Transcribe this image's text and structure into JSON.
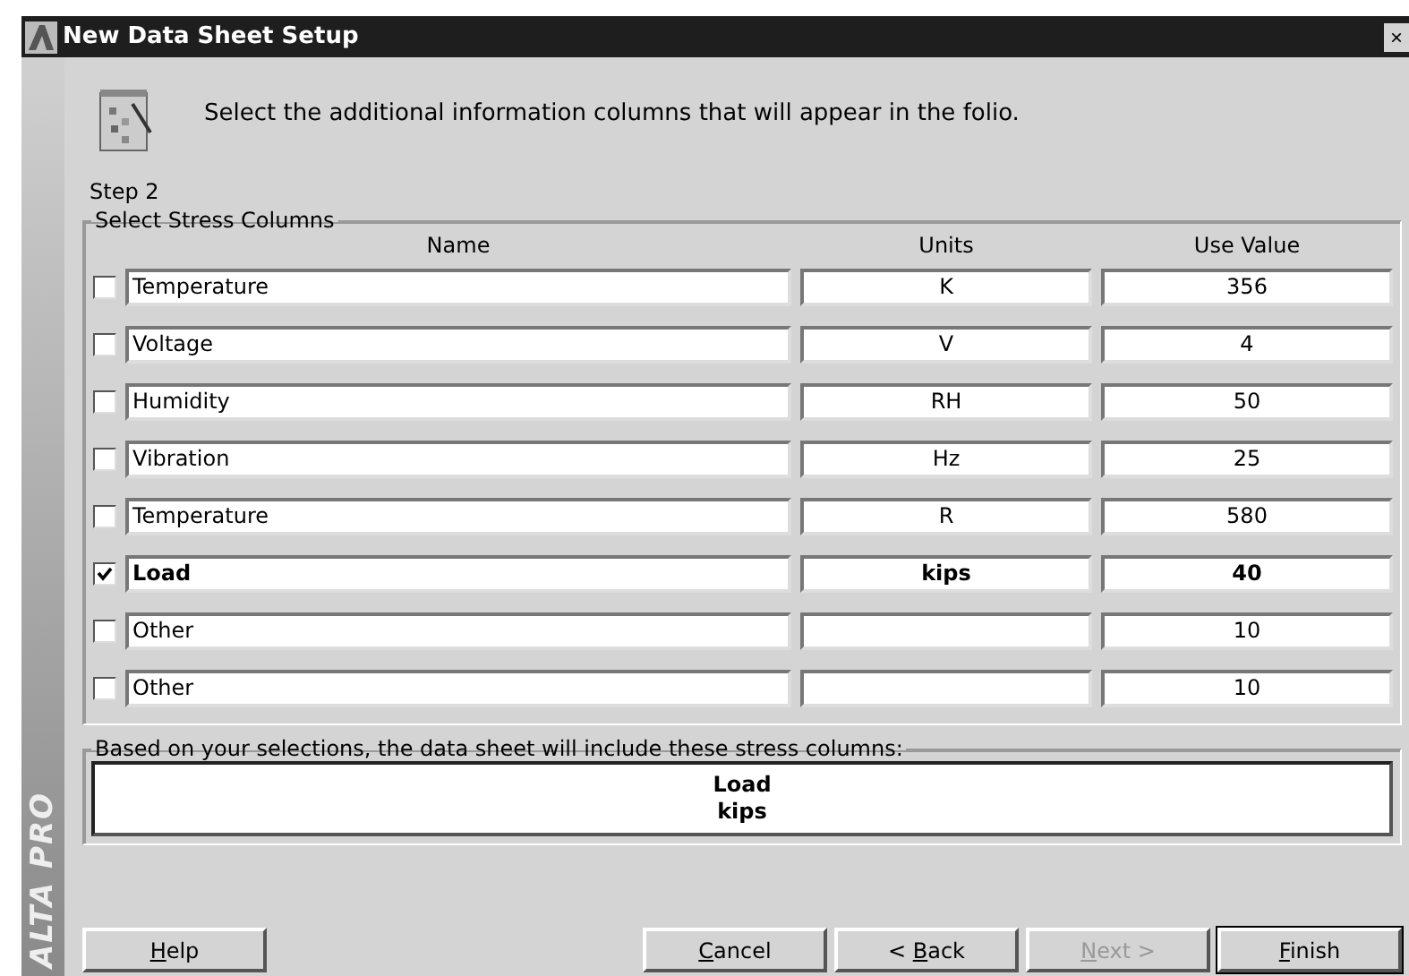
{
  "window": {
    "title": "New Data Sheet Setup",
    "close": "×"
  },
  "header": {
    "instruction": "Select the additional information columns that will appear in the folio.",
    "step": "Step 2"
  },
  "sidebar": {
    "brand": "ALTA PRO"
  },
  "stress_columns": {
    "legend": "Select Stress Columns",
    "columns": [
      "Name",
      "Units",
      "Use Value"
    ],
    "rows": [
      {
        "checked": false,
        "name": "Temperature",
        "units": "K",
        "value": "356"
      },
      {
        "checked": false,
        "name": "Voltage",
        "units": "V",
        "value": "4"
      },
      {
        "checked": false,
        "name": "Humidity",
        "units": "RH",
        "value": "50"
      },
      {
        "checked": false,
        "name": "Vibration",
        "units": "Hz",
        "value": "25"
      },
      {
        "checked": false,
        "name": "Temperature",
        "units": "R",
        "value": "580"
      },
      {
        "checked": true,
        "name": "Load",
        "units": "kips",
        "value": "40"
      },
      {
        "checked": false,
        "name": "Other",
        "value": "10"
      },
      {
        "checked": false,
        "name": "Other",
        "value": "10"
      }
    ]
  },
  "summary": {
    "legend": "Based on your selections, the data sheet will include these stress columns:",
    "lines": [
      "Load",
      "kips"
    ]
  },
  "buttons": [
    {
      "access_key": "H",
      "rest": "elp",
      "disabled": false,
      "default": false
    },
    {
      "access_key": "C",
      "rest": "ancel",
      "disabled": false,
      "default": false
    },
    {
      "prefix": "< ",
      "access_key": "B",
      "rest": "ack",
      "disabled": false,
      "default": false
    },
    {
      "access_key": "N",
      "rest": "ext >",
      "disabled": true,
      "default": false
    },
    {
      "access_key": "F",
      "rest": "inish",
      "disabled": false,
      "default": true
    }
  ]
}
